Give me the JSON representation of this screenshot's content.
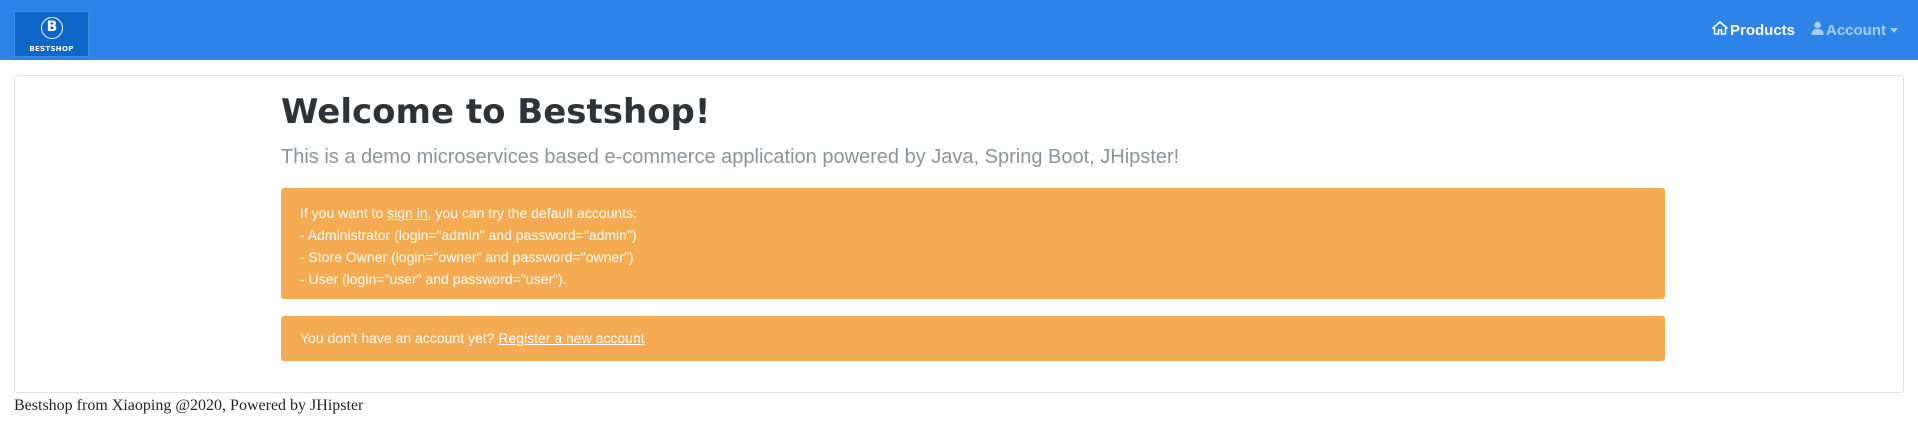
{
  "brand": {
    "logo_letter": "B",
    "name": "BESTSHOP"
  },
  "nav": {
    "products_label": "Products",
    "account_label": "Account"
  },
  "main": {
    "title": "Welcome to Bestshop!",
    "lead": "This is a demo microservices based e-commerce application powered by Java, Spring Boot, JHipster!",
    "signin_alert": {
      "prefix": "If you want to ",
      "link": "sign in",
      "suffix": ", you can try the default accounts:",
      "lines": [
        "- Administrator (login=\"admin\" and password=\"admin\")",
        "- Store Owner (login=\"owner\" and password=\"owner\")",
        "- User (login=\"user\" and password=\"user\")."
      ]
    },
    "register_alert": {
      "text": "You don't have an account yet? ",
      "link": "Register a new account"
    }
  },
  "footer": {
    "text": "Bestshop from Xiaoping @2020, Powered by JHipster"
  },
  "colors": {
    "navbar": "#2d83e8",
    "brand_bg": "#0f66c9",
    "alert_bg": "#f4ab51",
    "title": "#2e3338",
    "lead": "#8a949b"
  },
  "icons": [
    "home-icon",
    "user-icon",
    "chevron-down-icon"
  ]
}
